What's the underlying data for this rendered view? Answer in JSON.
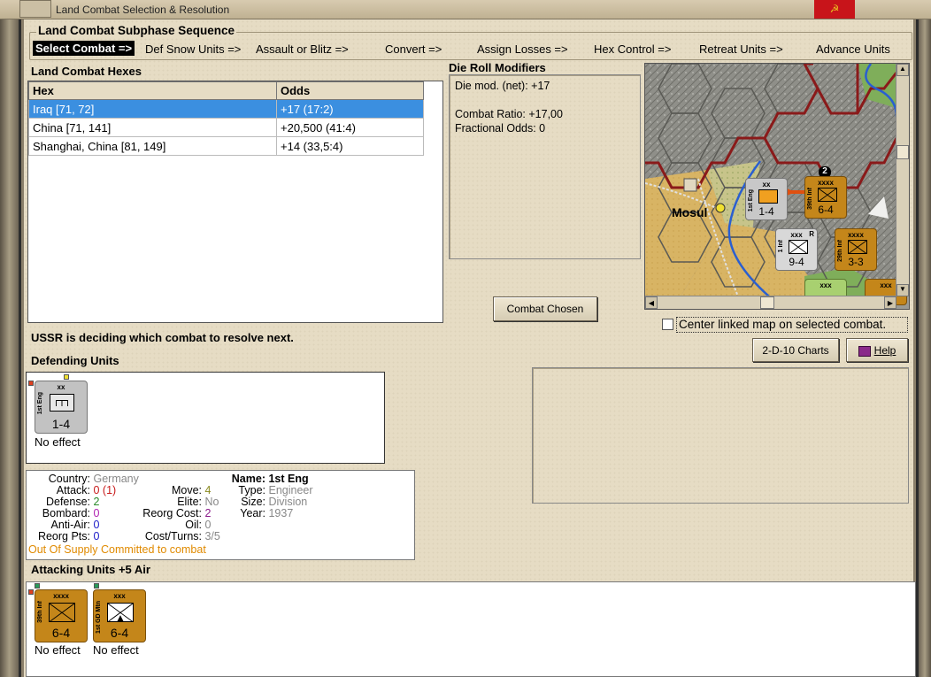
{
  "window": {
    "title": "Land Combat Selection & Resolution",
    "close_glyph": "☭"
  },
  "subphase": {
    "title": "Land Combat Subphase Sequence",
    "steps": [
      "Select Combat =>",
      "Def Snow Units =>",
      "Assault or Blitz =>",
      "Convert =>",
      "Assign Losses =>",
      "Hex Control =>",
      "Retreat Units =>",
      "Advance Units"
    ]
  },
  "hexes": {
    "title": "Land Combat Hexes",
    "columns": [
      "Hex",
      "Odds"
    ],
    "rows": [
      {
        "hex": "Iraq [71, 72]",
        "odds": "+17 (17:2)"
      },
      {
        "hex": "China [71, 141]",
        "odds": "+20,500 (41:4)"
      },
      {
        "hex": "Shanghai, China [81, 149]",
        "odds": "+14 (33,5:4)"
      }
    ]
  },
  "modifiers": {
    "title": "Die Roll Modifiers",
    "line1": "Die mod. (net): +17",
    "line2": "Combat Ratio: +17,00",
    "line3": "Fractional Odds: 0"
  },
  "map": {
    "city": "Mosul",
    "stack_count": "2",
    "units": [
      {
        "name": "1st Eng",
        "size": "xx",
        "str": "1-4"
      },
      {
        "name": "39th Inf",
        "size": "xxxx",
        "str": "6-4"
      },
      {
        "name": "1 Inf",
        "size": "xxx",
        "str": "9-4"
      },
      {
        "name": "29th Inf",
        "size": "xxxx",
        "str": "3-3"
      },
      {
        "name": "",
        "size": "xxx",
        "str": ""
      },
      {
        "name": "",
        "size": "xxx",
        "str": ""
      }
    ],
    "corner_mark": "R"
  },
  "buttons": {
    "combat_chosen": "Combat Chosen",
    "charts": "2-D-10 Charts",
    "help": "Help"
  },
  "center_linked": "Center linked map on selected combat.",
  "status": "USSR is deciding which combat to resolve next.",
  "defending": {
    "title": "Defending Units",
    "units": [
      {
        "name": "1st Eng",
        "size": "xx",
        "str": "1-4",
        "result": "No effect"
      }
    ]
  },
  "details": {
    "country_k": "Country:",
    "country": "Germany",
    "attack_k": "Attack:",
    "attack": "0",
    "attack_mod": "(1)",
    "defense_k": "Defense:",
    "defense": "2",
    "bombard_k": "Bombard:",
    "bombard": "0",
    "antiair_k": "Anti-Air:",
    "antiair": "0",
    "reorgpts_k": "Reorg Pts:",
    "reorgpts": "0",
    "move_k": "Move:",
    "move": "4",
    "elite_k": "Elite:",
    "elite": "No",
    "reorgcost_k": "Reorg Cost:",
    "reorgcost": "2",
    "oil_k": "Oil:",
    "oil": "0",
    "costturns_k": "Cost/Turns:",
    "costturns": "3/5",
    "name_k": "Name:",
    "name": "1st Eng",
    "type_k": "Type:",
    "type": "Engineer",
    "size_k": "Size:",
    "size": "Division",
    "year_k": "Year:",
    "year": "1937",
    "supply": "Out Of Supply",
    "committed": "Committed to combat"
  },
  "attacking": {
    "title": "Attacking Units +5 Air",
    "units": [
      {
        "name": "39th Inf",
        "size": "xxxx",
        "str": "6-4",
        "result": "No effect"
      },
      {
        "name": "1st GD Mtn",
        "size": "xxx",
        "str": "6-4",
        "result": "No effect"
      }
    ]
  },
  "colors": {
    "selected_row": "#3b8fe0",
    "unit_gold": "#c4861a",
    "border_red": "#8a1a1a",
    "supply_orange": "#e08a00"
  }
}
